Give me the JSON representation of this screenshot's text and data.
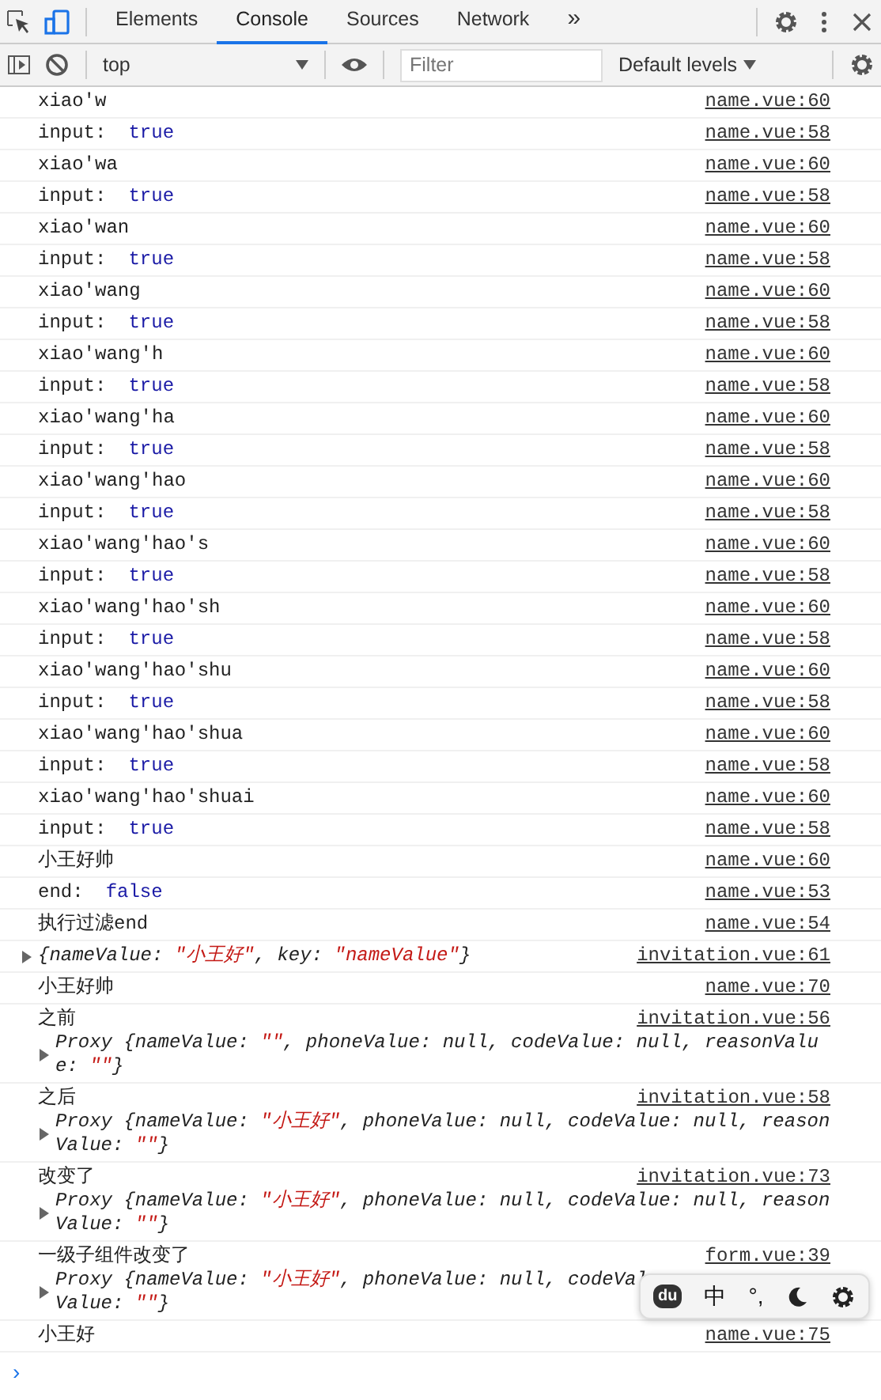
{
  "toolbar": {
    "tabs": [
      {
        "label": "Elements",
        "selected": false
      },
      {
        "label": "Console",
        "selected": true
      },
      {
        "label": "Sources",
        "selected": false
      },
      {
        "label": "Network",
        "selected": false
      }
    ],
    "overflow": "»"
  },
  "filter_bar": {
    "context": "top",
    "filter": {
      "placeholder": "Filter"
    },
    "levels": "Default levels"
  },
  "messages": [
    {
      "args": [
        {
          "text": "xiao'w",
          "kind": "text"
        }
      ],
      "source": "name.vue:60"
    },
    {
      "args": [
        {
          "text": "input:",
          "kind": "text"
        },
        {
          "text": "true",
          "kind": "boolean"
        }
      ],
      "source": "name.vue:58"
    },
    {
      "args": [
        {
          "text": "xiao'wa",
          "kind": "text"
        }
      ],
      "source": "name.vue:60"
    },
    {
      "args": [
        {
          "text": "input:",
          "kind": "text"
        },
        {
          "text": "true",
          "kind": "boolean"
        }
      ],
      "source": "name.vue:58"
    },
    {
      "args": [
        {
          "text": "xiao'wan",
          "kind": "text"
        }
      ],
      "source": "name.vue:60"
    },
    {
      "args": [
        {
          "text": "input:",
          "kind": "text"
        },
        {
          "text": "true",
          "kind": "boolean"
        }
      ],
      "source": "name.vue:58"
    },
    {
      "args": [
        {
          "text": "xiao'wang",
          "kind": "text"
        }
      ],
      "source": "name.vue:60"
    },
    {
      "args": [
        {
          "text": "input:",
          "kind": "text"
        },
        {
          "text": "true",
          "kind": "boolean"
        }
      ],
      "source": "name.vue:58"
    },
    {
      "args": [
        {
          "text": "xiao'wang'h",
          "kind": "text"
        }
      ],
      "source": "name.vue:60"
    },
    {
      "args": [
        {
          "text": "input:",
          "kind": "text"
        },
        {
          "text": "true",
          "kind": "boolean"
        }
      ],
      "source": "name.vue:58"
    },
    {
      "args": [
        {
          "text": "xiao'wang'ha",
          "kind": "text"
        }
      ],
      "source": "name.vue:60"
    },
    {
      "args": [
        {
          "text": "input:",
          "kind": "text"
        },
        {
          "text": "true",
          "kind": "boolean"
        }
      ],
      "source": "name.vue:58"
    },
    {
      "args": [
        {
          "text": "xiao'wang'hao",
          "kind": "text"
        }
      ],
      "source": "name.vue:60"
    },
    {
      "args": [
        {
          "text": "input:",
          "kind": "text"
        },
        {
          "text": "true",
          "kind": "boolean"
        }
      ],
      "source": "name.vue:58"
    },
    {
      "args": [
        {
          "text": "xiao'wang'hao's",
          "kind": "text"
        }
      ],
      "source": "name.vue:60"
    },
    {
      "args": [
        {
          "text": "input:",
          "kind": "text"
        },
        {
          "text": "true",
          "kind": "boolean"
        }
      ],
      "source": "name.vue:58"
    },
    {
      "args": [
        {
          "text": "xiao'wang'hao'sh",
          "kind": "text"
        }
      ],
      "source": "name.vue:60"
    },
    {
      "args": [
        {
          "text": "input:",
          "kind": "text"
        },
        {
          "text": "true",
          "kind": "boolean"
        }
      ],
      "source": "name.vue:58"
    },
    {
      "args": [
        {
          "text": "xiao'wang'hao'shu",
          "kind": "text"
        }
      ],
      "source": "name.vue:60"
    },
    {
      "args": [
        {
          "text": "input:",
          "kind": "text"
        },
        {
          "text": "true",
          "kind": "boolean"
        }
      ],
      "source": "name.vue:58"
    },
    {
      "args": [
        {
          "text": "xiao'wang'hao'shua",
          "kind": "text"
        }
      ],
      "source": "name.vue:60"
    },
    {
      "args": [
        {
          "text": "input:",
          "kind": "text"
        },
        {
          "text": "true",
          "kind": "boolean"
        }
      ],
      "source": "name.vue:58"
    },
    {
      "args": [
        {
          "text": "xiao'wang'hao'shuai",
          "kind": "text"
        }
      ],
      "source": "name.vue:60"
    },
    {
      "args": [
        {
          "text": "input:",
          "kind": "text"
        },
        {
          "text": "true",
          "kind": "boolean"
        }
      ],
      "source": "name.vue:58"
    },
    {
      "args": [
        {
          "text": "小王好帅",
          "kind": "text"
        }
      ],
      "source": "name.vue:60"
    },
    {
      "args": [
        {
          "text": "end:",
          "kind": "text"
        },
        {
          "text": "false",
          "kind": "boolean"
        }
      ],
      "source": "name.vue:53"
    },
    {
      "args": [
        {
          "text": "执行过滤end",
          "kind": "text"
        }
      ],
      "source": "name.vue:54"
    },
    {
      "object": {
        "expanded": false,
        "lines": [
          [
            {
              "text": "{nameValue: ",
              "kind": "plain"
            },
            {
              "text": "\"小王好\"",
              "kind": "string"
            },
            {
              "text": ", key: ",
              "kind": "plain"
            },
            {
              "text": "\"nameValue\"",
              "kind": "string"
            },
            {
              "text": "}",
              "kind": "plain"
            }
          ]
        ]
      },
      "source": "invitation.vue:61"
    },
    {
      "args": [
        {
          "text": "小王好帅",
          "kind": "text"
        }
      ],
      "source": "name.vue:70"
    },
    {
      "args": [
        {
          "text": "之前",
          "kind": "text"
        }
      ],
      "object": {
        "expanded": false,
        "lines": [
          [
            {
              "text": "Proxy {nameValue: ",
              "kind": "plain"
            },
            {
              "text": "\"\"",
              "kind": "string"
            },
            {
              "text": ", phoneValue: null, codeValue: null, reasonValu",
              "kind": "plain"
            }
          ],
          [
            {
              "text": "e: ",
              "kind": "plain"
            },
            {
              "text": "\"\"",
              "kind": "string"
            },
            {
              "text": "}",
              "kind": "plain"
            }
          ]
        ]
      },
      "source": "invitation.vue:56"
    },
    {
      "args": [
        {
          "text": "之后",
          "kind": "text"
        }
      ],
      "object": {
        "expanded": false,
        "lines": [
          [
            {
              "text": "Proxy {nameValue: ",
              "kind": "plain"
            },
            {
              "text": "\"小王好\"",
              "kind": "string"
            },
            {
              "text": ", phoneValue: null, codeValue: null, reason",
              "kind": "plain"
            }
          ],
          [
            {
              "text": "Value: ",
              "kind": "plain"
            },
            {
              "text": "\"\"",
              "kind": "string"
            },
            {
              "text": "}",
              "kind": "plain"
            }
          ]
        ]
      },
      "source": "invitation.vue:58"
    },
    {
      "args": [
        {
          "text": "改变了",
          "kind": "text"
        }
      ],
      "object": {
        "expanded": false,
        "lines": [
          [
            {
              "text": "Proxy {nameValue: ",
              "kind": "plain"
            },
            {
              "text": "\"小王好\"",
              "kind": "string"
            },
            {
              "text": ", phoneValue: null, codeValue: null, reason",
              "kind": "plain"
            }
          ],
          [
            {
              "text": "Value: ",
              "kind": "plain"
            },
            {
              "text": "\"\"",
              "kind": "string"
            },
            {
              "text": "}",
              "kind": "plain"
            }
          ]
        ]
      },
      "source": "invitation.vue:73"
    },
    {
      "args": [
        {
          "text": "一级子组件改变了",
          "kind": "text"
        }
      ],
      "object": {
        "expanded": false,
        "lines": [
          [
            {
              "text": "Proxy {nameValue: ",
              "kind": "plain"
            },
            {
              "text": "\"小王好\"",
              "kind": "string"
            },
            {
              "text": ", phoneValue: null, codeVal",
              "kind": "plain"
            }
          ],
          [
            {
              "text": "Value: ",
              "kind": "plain"
            },
            {
              "text": "\"\"",
              "kind": "string"
            },
            {
              "text": "}",
              "kind": "plain"
            }
          ]
        ]
      },
      "source": "form.vue:39"
    },
    {
      "args": [
        {
          "text": "小王好",
          "kind": "text"
        }
      ],
      "source": "name.vue:75"
    }
  ],
  "prompt": "›",
  "ime_bar": {
    "logo": "du",
    "mode": "中",
    "punctuation": "°,"
  }
}
